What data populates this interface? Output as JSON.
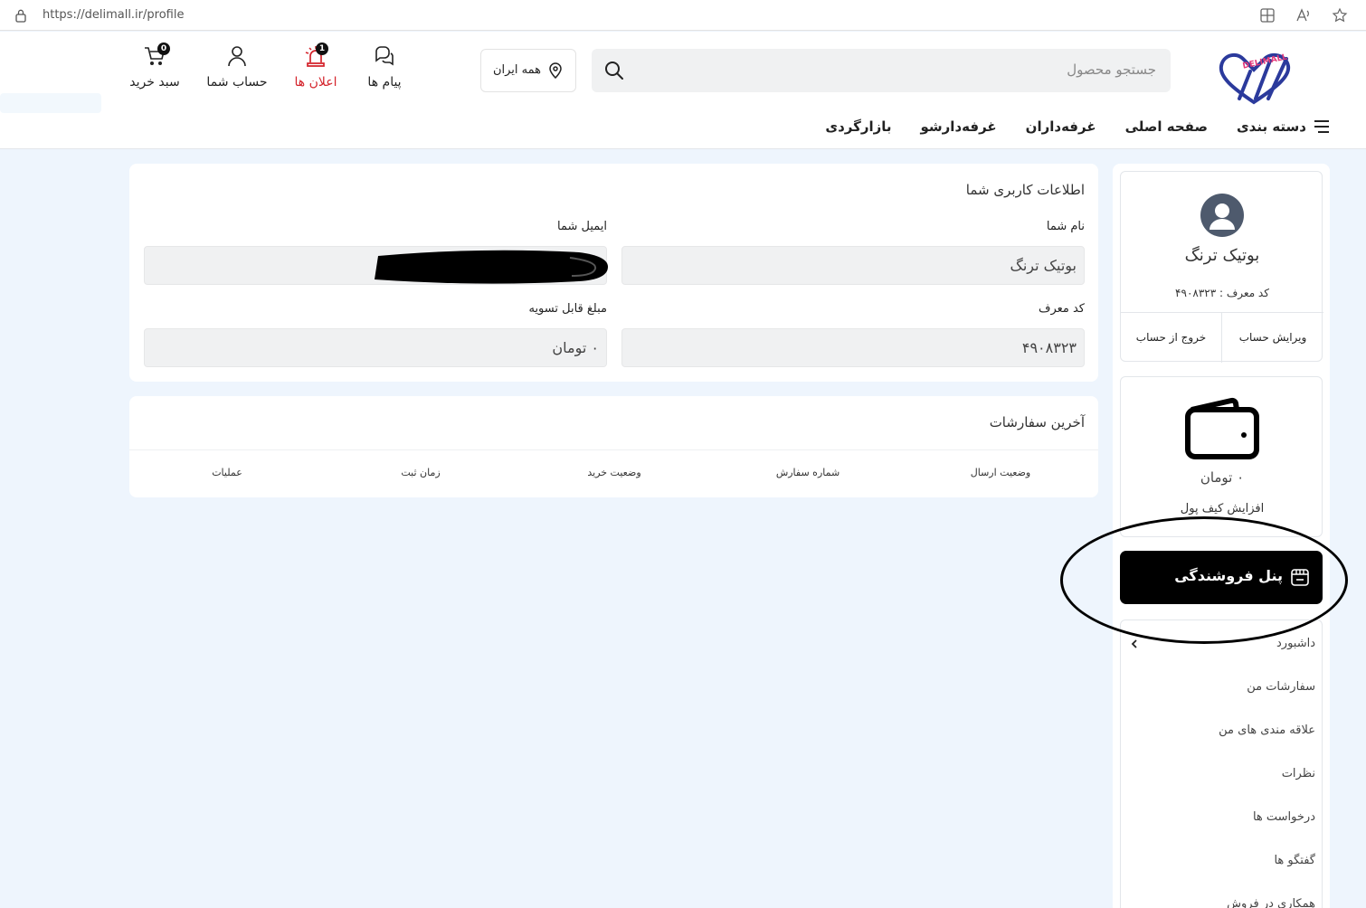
{
  "browser": {
    "url": "https://delimall.ir/profile"
  },
  "header": {
    "logo_text": "DELIMALL",
    "search_placeholder": "جستجو محصول",
    "region_label": "همه ایران",
    "actions": [
      {
        "label": "پیام ها",
        "icon": "chat-icon"
      },
      {
        "label": "اعلان ها",
        "icon": "siren-icon",
        "badge": "1"
      },
      {
        "label": "حساب شما",
        "icon": "user-icon"
      },
      {
        "label": "سبد خرید",
        "icon": "cart-icon",
        "badge": "0"
      }
    ]
  },
  "nav": {
    "categories_label": "دسته بندی",
    "items": [
      "صفحه اصلی",
      "غرفه‌داران",
      "غرفه‌دارشو",
      "بازارگردی"
    ]
  },
  "sidebar": {
    "profile_name": "بوتیک ترنگ",
    "referral_code": "کد معرف : ۴۹۰۸۳۲۳",
    "edit_account": "ویرایش حساب",
    "logout": "خروج از حساب",
    "wallet_balance": "۰ تومان",
    "wallet_topup": "افزایش کیف پول",
    "vendor_panel": "پنل فروشندگی",
    "menu": [
      "داشبورد",
      "سفارشات من",
      "علاقه مندی های من",
      "نظرات",
      "درخواست ها",
      "گفتگو ها",
      "همکاری در فروش"
    ]
  },
  "user_info": {
    "title": "اطلاعات کاربری شما",
    "name_label": "نام شما",
    "name_value": "بوتیک ترنگ",
    "email_label": "ایمیل شما",
    "email_value": "",
    "ref_label": "کد معرف",
    "ref_value": "۴۹۰۸۳۲۳",
    "settle_label": "مبلغ قابل تسویه",
    "settle_value": "۰ تومان"
  },
  "orders": {
    "title": "آخرین سفارشات",
    "columns": [
      "وضعیت ارسال",
      "شماره سفارش",
      "وضعیت خرید",
      "زمان ثبت",
      "عملیات"
    ]
  },
  "colors": {
    "accent_red": "#d4232b",
    "logo_blue": "#2b3a9c",
    "logo_pink": "#e33a7a",
    "page_bg": "#eef5fd"
  }
}
